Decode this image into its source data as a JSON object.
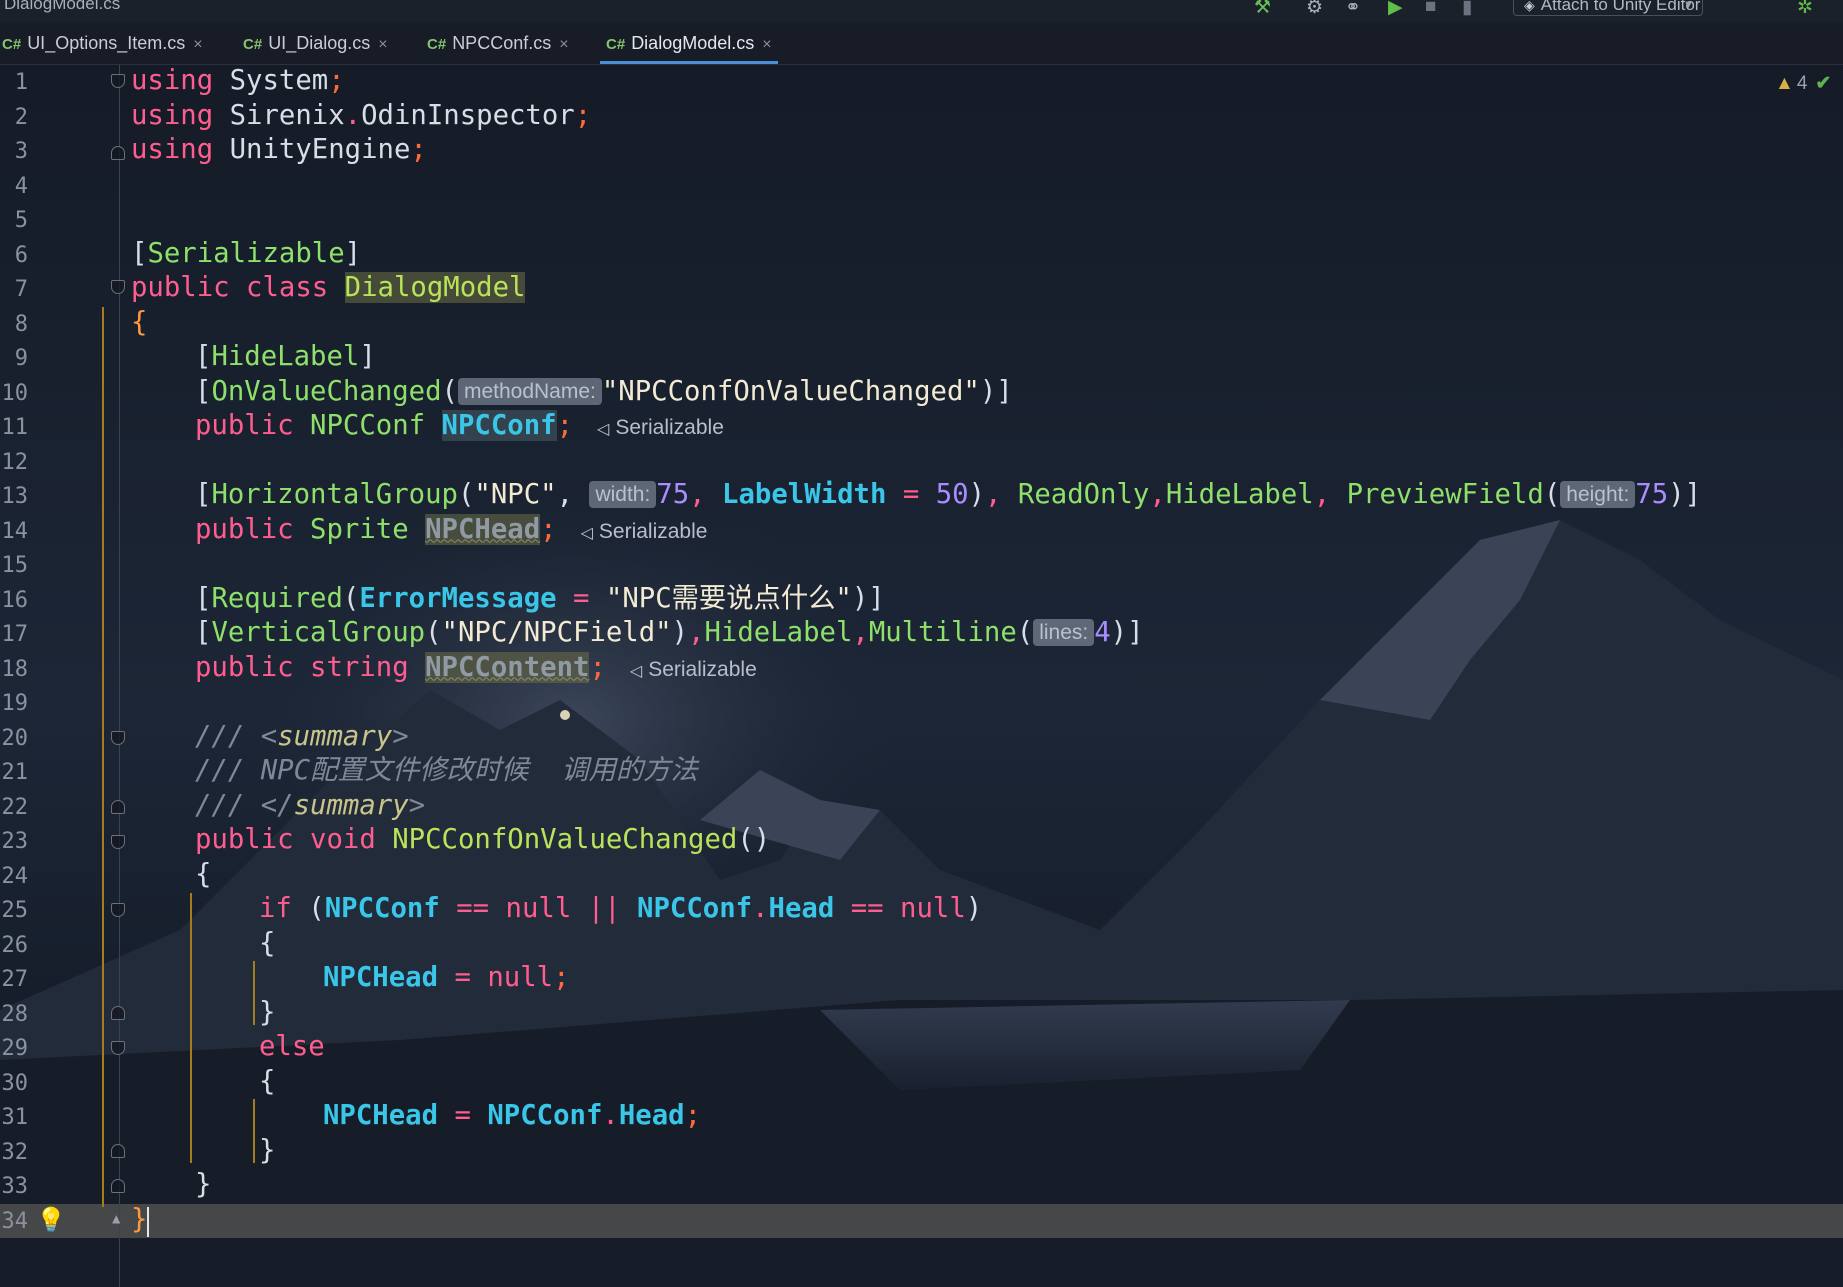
{
  "topbar": {
    "file_name": "DialogModel.cs",
    "attach_label": "Attach to Unity Editor"
  },
  "tabs": [
    {
      "icon": "C#",
      "label": "UI_Options_Item.cs",
      "active": false
    },
    {
      "icon": "C#",
      "label": "UI_Dialog.cs",
      "active": false
    },
    {
      "icon": "C#",
      "label": "NPCConf.cs",
      "active": false
    },
    {
      "icon": "C#",
      "label": "DialogModel.cs",
      "active": true
    }
  ],
  "inspection": {
    "warning_count": "4"
  },
  "line_numbers": [
    "1",
    "2",
    "3",
    "4",
    "5",
    "6",
    "7",
    "8",
    "9",
    "10",
    "11",
    "12",
    "13",
    "14",
    "15",
    "16",
    "17",
    "18",
    "19",
    "20",
    "21",
    "22",
    "23",
    "24",
    "25",
    "26",
    "27",
    "28",
    "29",
    "30",
    "31",
    "32",
    "33",
    "34"
  ],
  "code": {
    "l1": {
      "kw": "using",
      "name": "System"
    },
    "l2": {
      "kw": "using",
      "ns1": "Sirenix",
      "ns2": "OdinInspector"
    },
    "l3": {
      "kw": "using",
      "name": "UnityEngine"
    },
    "l6": {
      "attr": "Serializable"
    },
    "l7": {
      "kw1": "public",
      "kw2": "class",
      "name": "DialogModel"
    },
    "l9": {
      "attr": "HideLabel"
    },
    "l10": {
      "attr": "OnValueChanged",
      "hint": "methodName:",
      "str": "\"NPCConfOnValueChanged\""
    },
    "l11": {
      "kw": "public",
      "type": "NPCConf",
      "name": "NPCConf",
      "annot": "Serializable"
    },
    "l13": {
      "attr1": "HorizontalGroup",
      "str": "\"NPC\"",
      "hint1": "width:",
      "num1": "75",
      "prop": "LabelWidth",
      "num2": "50",
      "attr2": "ReadOnly",
      "attr3": "HideLabel",
      "attr4": "PreviewField",
      "hint2": "height:",
      "num3": "75"
    },
    "l14": {
      "kw": "public",
      "type": "Sprite",
      "name": "NPCHead",
      "annot": "Serializable"
    },
    "l16": {
      "attr": "Required",
      "prop": "ErrorMessage",
      "str": "\"NPC需要说点什么\""
    },
    "l17": {
      "attr1": "VerticalGroup",
      "str": "\"NPC/NPCField\"",
      "attr2": "HideLabel",
      "attr3": "Multiline",
      "hint": "lines:",
      "num": "4"
    },
    "l18": {
      "kw1": "public",
      "kw2": "string",
      "name": "NPCContent",
      "annot": "Serializable"
    },
    "l20": {
      "slashes": "///",
      "tag": "summary"
    },
    "l21": {
      "slashes": "///",
      "text": "NPC配置文件修改时候  调用的方法"
    },
    "l22": {
      "slashes": "///",
      "tag": "summary"
    },
    "l23": {
      "kw1": "public",
      "kw2": "void",
      "name": "NPCConfOnValueChanged"
    },
    "l25": {
      "kw": "if",
      "a": "NPCConf",
      "null1": "null",
      "b": "NPCConf",
      "c": "Head",
      "null2": "null"
    },
    "l27": {
      "name": "NPCHead",
      "null": "null"
    },
    "l29": {
      "kw": "else"
    },
    "l31": {
      "name": "NPCHead",
      "a": "NPCConf",
      "b": "Head"
    }
  }
}
